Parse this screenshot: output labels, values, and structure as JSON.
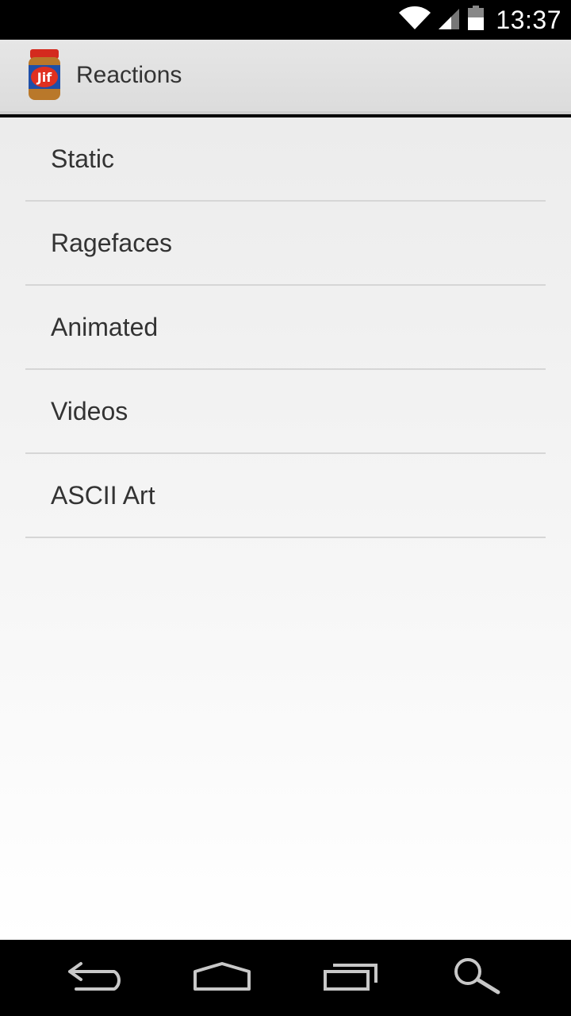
{
  "status_bar": {
    "time": "13:37",
    "icons": [
      "wifi-icon",
      "signal-icon",
      "battery-icon"
    ]
  },
  "action_bar": {
    "title": "Reactions",
    "app_icon": "jif-jar-icon",
    "app_icon_text": "Jif"
  },
  "menu": {
    "items": [
      {
        "label": "Static"
      },
      {
        "label": "Ragefaces"
      },
      {
        "label": "Animated"
      },
      {
        "label": "Videos"
      },
      {
        "label": "ASCII Art"
      }
    ]
  },
  "nav_bar": {
    "buttons": [
      "back-icon",
      "home-icon",
      "recents-icon",
      "search-icon"
    ]
  },
  "colors": {
    "action_bar": "#dcdcdc",
    "list_text": "#333333",
    "divider": "#d6d6d6",
    "system_bars": "#000000"
  }
}
